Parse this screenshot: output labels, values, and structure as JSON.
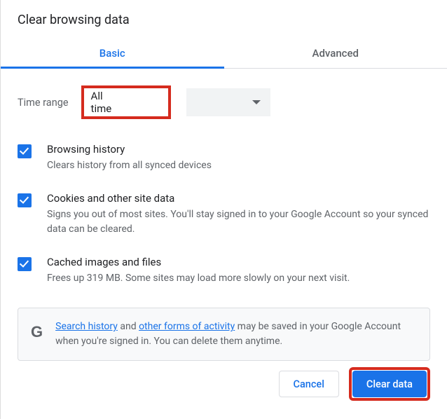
{
  "dialog": {
    "title": "Clear browsing data"
  },
  "tabs": {
    "basic": "Basic",
    "advanced": "Advanced"
  },
  "timerange": {
    "label": "Time range",
    "value": "All time"
  },
  "options": {
    "history": {
      "title": "Browsing history",
      "desc": "Clears history from all synced devices",
      "checked": true
    },
    "cookies": {
      "title": "Cookies and other site data",
      "desc": "Signs you out of most sites. You'll stay signed in to your Google Account so your synced data can be cleared.",
      "checked": true
    },
    "cache": {
      "title": "Cached images and files",
      "desc": "Frees up 319 MB. Some sites may load more slowly on your next visit.",
      "checked": true
    }
  },
  "info": {
    "link1": "Search history",
    "mid1": " and ",
    "link2": "other forms of activity",
    "rest": " may be saved in your Google Account when you're signed in. You can delete them anytime."
  },
  "buttons": {
    "cancel": "Cancel",
    "clear": "Clear data"
  }
}
